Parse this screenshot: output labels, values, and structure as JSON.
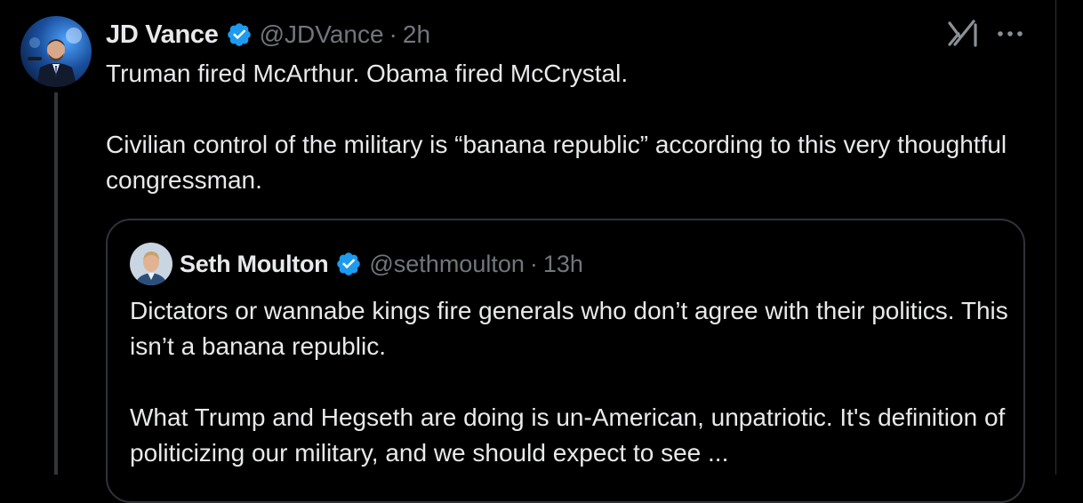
{
  "tweet": {
    "author_name": "JD Vance",
    "handle": "@JDVance",
    "separator": "·",
    "time": "2h",
    "text_line_1": "Truman fired McArthur. Obama fired McCrystal.",
    "text_paragraph_2": "Civilian control of the military is “banana republic” according to this very thoughtful congressman."
  },
  "quote": {
    "author_name": "Seth Moulton",
    "handle": "@sethmoulton",
    "separator": "·",
    "time": "13h",
    "text_paragraph_1": "Dictators or wannabe kings fire generals who don’t agree with their politics. This isn’t a banana republic.",
    "text_paragraph_2": "What Trump and Hegseth are doing is un-American, unpatriotic. It's definition of politicizing our military, and we should expect to see ..."
  },
  "icons": {
    "verified": "verified-badge-icon",
    "grok": "grok-icon",
    "more": "more-dots-icon"
  },
  "colors": {
    "background": "#000000",
    "text_primary": "#e7e9ea",
    "text_secondary": "#71767b",
    "verified_badge": "#1d9bf0",
    "border": "#2f3336"
  }
}
